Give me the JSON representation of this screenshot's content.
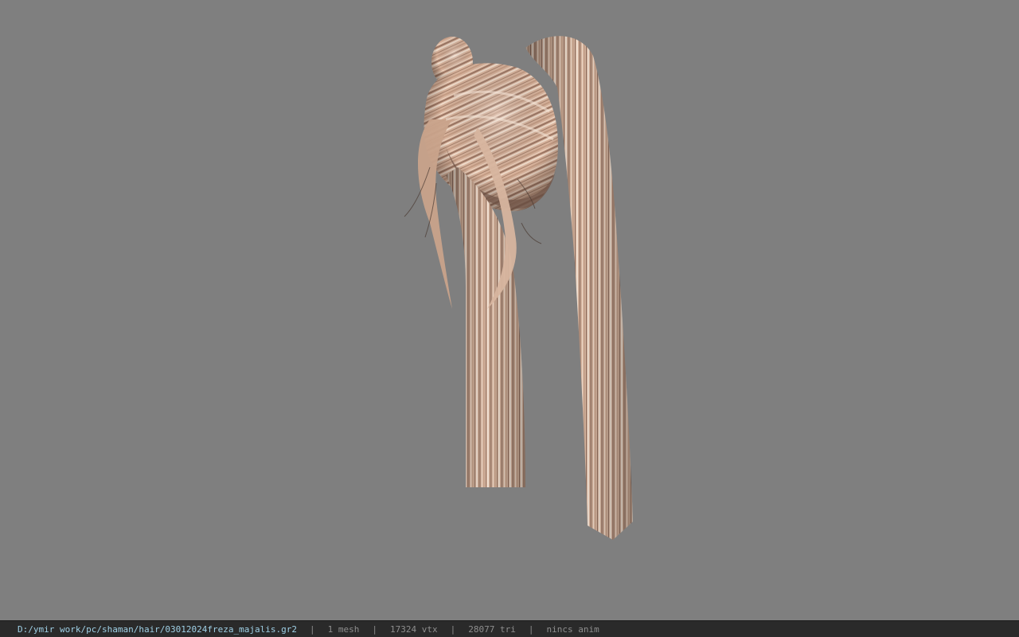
{
  "viewer": {
    "background_color": "#7f7f7f",
    "model": {
      "description_icon": "hair-model-icon"
    }
  },
  "statusbar": {
    "file_path": "D:/ymir work/pc/shaman/hair/03012024freza_majalis.gr2",
    "separator": "|",
    "mesh_count": "1 mesh",
    "vertex_count": "17324 vtx",
    "triangle_count": "28077 tri",
    "anim_status": "nincs anim",
    "path_color": "#9fd0e6",
    "text_color": "#8e8e8e",
    "bg_color": "#2a2a2a"
  }
}
